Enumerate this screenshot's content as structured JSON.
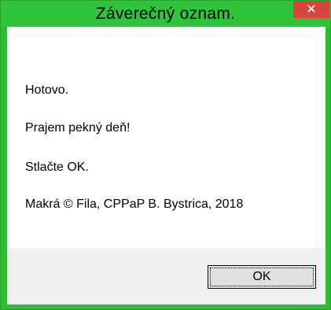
{
  "window": {
    "title": "Záverečný oznam.",
    "close_icon": "close-x-icon"
  },
  "messages": [
    "Hotovo.",
    "Prajem pekný deň!",
    "Stlačte OK.",
    "Makrá © Fila, CPPaP B. Bystrica, 2018"
  ],
  "buttons": {
    "ok_label": "OK"
  },
  "colors": {
    "titlebar": "#2fc43a",
    "frame": "#2bbd34",
    "close_button": "#d8453c",
    "footer": "#f0f0f0",
    "button_face": "#e1e1e1"
  }
}
